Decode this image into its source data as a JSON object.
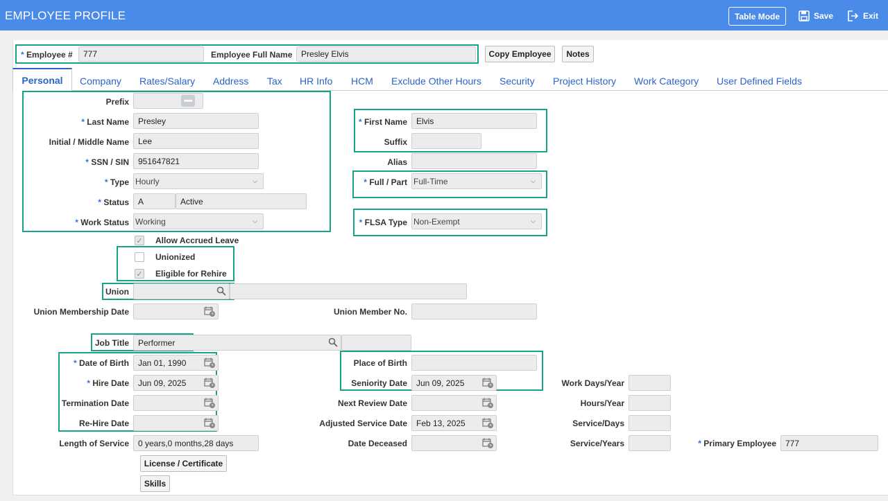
{
  "header": {
    "title": "EMPLOYEE PROFILE",
    "table_mode": "Table Mode",
    "save": "Save",
    "exit": "Exit"
  },
  "top": {
    "employee_no_label": "Employee #",
    "employee_no": "777",
    "full_name_label": "Employee Full Name",
    "full_name": "Presley Elvis",
    "copy_employee": "Copy Employee",
    "notes": "Notes"
  },
  "tabs": [
    "Personal",
    "Company",
    "Rates/Salary",
    "Address",
    "Tax",
    "HR Info",
    "HCM",
    "Exclude Other Hours",
    "Security",
    "Project History",
    "Work Category",
    "User Defined Fields"
  ],
  "form": {
    "prefix_label": "Prefix",
    "last_name_label": "Last Name",
    "last_name": "Presley",
    "middle_label": "Initial / Middle Name",
    "middle": "Lee",
    "ssn_label": "SSN / SIN",
    "ssn": "951647821",
    "type_label": "Type",
    "type": "Hourly",
    "status_label": "Status",
    "status_code": "A",
    "status_desc": "Active",
    "work_status_label": "Work Status",
    "work_status": "Working",
    "first_name_label": "First Name",
    "first_name": "Elvis",
    "suffix_label": "Suffix",
    "alias_label": "Alias",
    "full_part_label": "Full / Part",
    "full_part": "Full-Time",
    "flsa_label": "FLSA Type",
    "flsa": "Non-Exempt",
    "allow_accrued": "Allow Accrued Leave",
    "unionized": "Unionized",
    "eligible_rehire": "Eligible for Rehire",
    "union_label": "Union",
    "union_membership_date_label": "Union Membership Date",
    "union_member_no_label": "Union Member No.",
    "job_title_label": "Job Title",
    "job_title": "Performer",
    "dob_label": "Date of Birth",
    "dob": "Jan 01, 1990",
    "hire_label": "Hire Date",
    "hire": "Jun 09, 2025",
    "termination_label": "Termination Date",
    "rehire_label": "Re-Hire Date",
    "los_label": "Length of Service",
    "los": "0 years,0 months,28 days",
    "place_birth_label": "Place of Birth",
    "seniority_label": "Seniority Date",
    "seniority": "Jun 09, 2025",
    "next_review_label": "Next Review Date",
    "adjusted_label": "Adjusted Service Date",
    "adjusted": "Feb 13, 2025",
    "deceased_label": "Date Deceased",
    "work_days_label": "Work Days/Year",
    "hours_year_label": "Hours/Year",
    "service_days_label": "Service/Days",
    "service_years_label": "Service/Years",
    "primary_label": "Primary Employee",
    "primary": "777",
    "license_btn": "License / Certificate",
    "skills_btn": "Skills"
  },
  "colors": {
    "header": "#4a8ae8",
    "highlight": "#18a386",
    "link": "#2b63c8"
  }
}
